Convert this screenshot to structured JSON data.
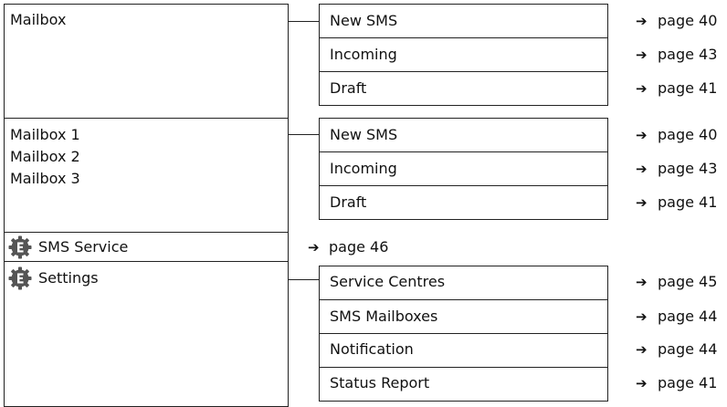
{
  "sections": [
    {
      "title_lines": [
        "Mailbox"
      ],
      "items": [
        {
          "label": "New SMS",
          "ref": "page 40"
        },
        {
          "label": "Incoming",
          "ref": "page 43"
        },
        {
          "label": "Draft",
          "ref": "page 41"
        }
      ]
    },
    {
      "title_lines": [
        "Mailbox 1",
        "Mailbox 2",
        "Mailbox 3"
      ],
      "items": [
        {
          "label": "New SMS",
          "ref": "page 40"
        },
        {
          "label": "Incoming",
          "ref": "page 43"
        },
        {
          "label": "Draft",
          "ref": "page 41"
        }
      ]
    },
    {
      "title_lines": [
        "SMS Service"
      ],
      "icon": "e-gear-icon",
      "ref": "page 46"
    },
    {
      "title_lines": [
        "Settings"
      ],
      "icon": "e-gear-icon",
      "items": [
        {
          "label": "Service Centres",
          "ref": "page 45"
        },
        {
          "label": "SMS Mailboxes",
          "ref": "page 44"
        },
        {
          "label": "Notification",
          "ref": "page 44"
        },
        {
          "label": "Status Report",
          "ref": "page 41"
        }
      ]
    }
  ],
  "arrow_glyph": "➔"
}
